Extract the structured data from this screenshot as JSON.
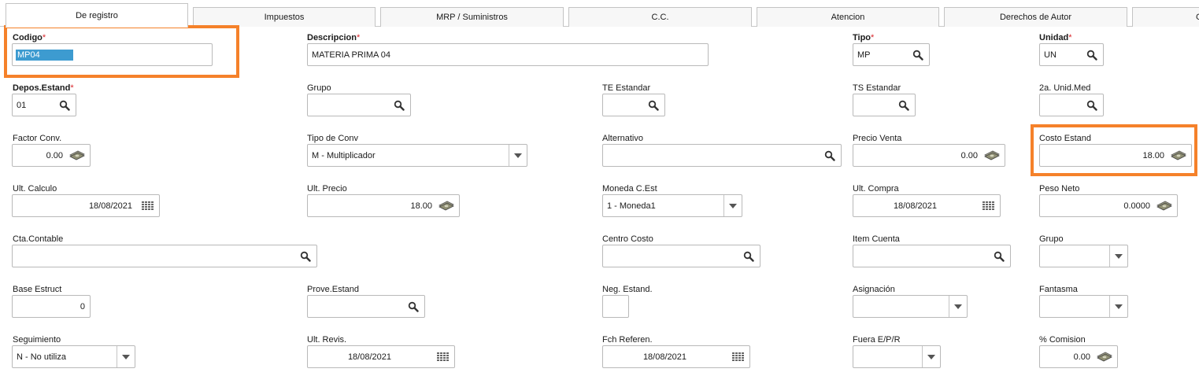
{
  "tabs": [
    {
      "label": "De registro",
      "active": true
    },
    {
      "label": "Impuestos"
    },
    {
      "label": "MRP / Suministros"
    },
    {
      "label": "C.C."
    },
    {
      "label": "Atencion"
    },
    {
      "label": "Derechos de Autor"
    },
    {
      "label": "Ga"
    }
  ],
  "required_marker": "*",
  "fields": {
    "codigo": {
      "label": "Codigo",
      "value": "MP04"
    },
    "descripcion": {
      "label": "Descripcion",
      "value": "MATERIA PRIMA 04"
    },
    "tipo": {
      "label": "Tipo",
      "value": "MP"
    },
    "unidad": {
      "label": "Unidad",
      "value": "UN"
    },
    "depos_estand": {
      "label": "Depos.Estand",
      "value": "01"
    },
    "grupo": {
      "label": "Grupo",
      "value": ""
    },
    "te_estandar": {
      "label": "TE Estandar",
      "value": ""
    },
    "ts_estandar": {
      "label": "TS Estandar",
      "value": ""
    },
    "segunda_unid_med": {
      "label": "2a. Unid.Med",
      "value": ""
    },
    "factor_conv": {
      "label": "Factor Conv.",
      "value": "0.00"
    },
    "tipo_conv": {
      "label": "Tipo de Conv",
      "value": "M - Multiplicador"
    },
    "alternativo": {
      "label": "Alternativo",
      "value": ""
    },
    "precio_venta": {
      "label": "Precio Venta",
      "value": "0.00"
    },
    "costo_estand": {
      "label": "Costo Estand",
      "value": "18.00"
    },
    "ult_calculo": {
      "label": "Ult. Calculo",
      "value": "18/08/2021"
    },
    "ult_precio": {
      "label": "Ult. Precio",
      "value": "18.00"
    },
    "moneda_c_est": {
      "label": "Moneda C.Est",
      "value": "1 - Moneda1"
    },
    "ult_compra": {
      "label": "Ult. Compra",
      "value": "18/08/2021"
    },
    "peso_neto": {
      "label": "Peso Neto",
      "value": "0.0000"
    },
    "cta_contable": {
      "label": "Cta.Contable",
      "value": ""
    },
    "centro_costo": {
      "label": "Centro Costo",
      "value": ""
    },
    "item_cuenta": {
      "label": "Item Cuenta",
      "value": ""
    },
    "grupo2": {
      "label": "Grupo",
      "value": ""
    },
    "base_estruct": {
      "label": "Base Estruct",
      "value": "0"
    },
    "prove_estand": {
      "label": "Prove.Estand",
      "value": ""
    },
    "neg_estand": {
      "label": "Neg. Estand.",
      "value": ""
    },
    "asignacion": {
      "label": "Asignación",
      "value": ""
    },
    "fantasma": {
      "label": "Fantasma",
      "value": ""
    },
    "seguimiento": {
      "label": "Seguimiento",
      "value": "N - No utiliza"
    },
    "ult_revis": {
      "label": "Ult. Revis.",
      "value": "18/08/2021"
    },
    "fch_referen": {
      "label": "Fch Referen.",
      "value": "18/08/2021"
    },
    "fuera_epr": {
      "label": "Fuera E/P/R",
      "value": ""
    },
    "pct_comision": {
      "label": "% Comision",
      "value": "0.00"
    }
  },
  "icons": {
    "lookup": "magnifier-icon",
    "money": "money-bills-icon",
    "calendar": "calendar-grid-icon",
    "dropdown": "triangle-down-icon"
  },
  "colors": {
    "highlight": "#f5812a",
    "required": "#d9252a",
    "selection": "#3d9bd0"
  }
}
